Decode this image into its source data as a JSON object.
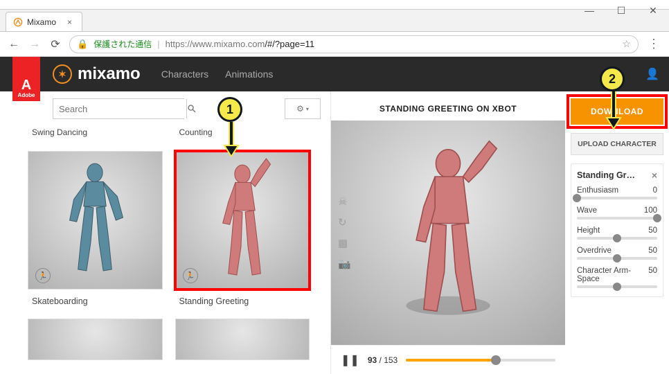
{
  "browser": {
    "tab_title": "Mixamo",
    "secure_label": "保護された通信",
    "url_host": "https://www.mixamo.com",
    "url_path": "/#/?page=11"
  },
  "header": {
    "brand": "mixamo",
    "adobe_label": "Adobe",
    "nav": {
      "characters": "Characters",
      "animations": "Animations"
    }
  },
  "left": {
    "search_placeholder": "Search",
    "items_top": [
      {
        "label": "Swing Dancing"
      },
      {
        "label": "Counting"
      }
    ],
    "items_main": [
      {
        "label": "Skateboarding",
        "selected": false,
        "tone": "blue"
      },
      {
        "label": "Standing Greeting",
        "selected": true,
        "tone": "pink"
      }
    ]
  },
  "viewer": {
    "title": "STANDING GREETING ON XBOT",
    "frame_current": "93",
    "frame_total": "153",
    "progress_pct": 60
  },
  "sidebar": {
    "download": "DOWNLOAD",
    "upload": "UPLOAD CHARACTER",
    "panel_title": "Standing Gr…",
    "params": [
      {
        "name": "Enthusiasm",
        "value": "0",
        "pos": 0
      },
      {
        "name": "Wave",
        "value": "100",
        "pos": 100
      },
      {
        "name": "Height",
        "value": "50",
        "pos": 50
      },
      {
        "name": "Overdrive",
        "value": "50",
        "pos": 50
      },
      {
        "name": "Character Arm-Space",
        "value": "50",
        "pos": 50
      }
    ]
  },
  "annotations": {
    "one": "1",
    "two": "2"
  }
}
